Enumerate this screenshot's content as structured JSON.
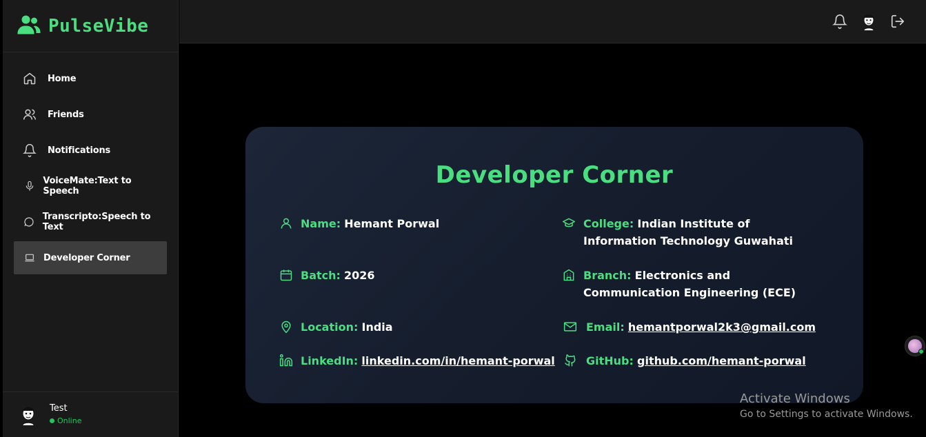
{
  "brand": {
    "name": "PulseVibe"
  },
  "sidebar": {
    "items": [
      {
        "label": "Home"
      },
      {
        "label": "Friends"
      },
      {
        "label": "Notifications"
      },
      {
        "label": "VoiceMate:Text to Speech"
      },
      {
        "label": "Transcripto:Speech to Text"
      },
      {
        "label": "Developer Corner",
        "active": true
      }
    ]
  },
  "user": {
    "name": "Test",
    "status": "Online"
  },
  "header": {
    "icons": [
      "bell-icon",
      "avatar",
      "logout-icon"
    ]
  },
  "card": {
    "title": "Developer Corner",
    "fields": {
      "name": {
        "key": "Name:",
        "value": "Hemant Porwal"
      },
      "college": {
        "key": "College:",
        "value": "Indian Institute of Information Technology Guwahati"
      },
      "batch": {
        "key": "Batch:",
        "value": "2026"
      },
      "branch": {
        "key": "Branch:",
        "value": "Electronics and Communication Engineering (ECE)"
      },
      "location": {
        "key": "Location:",
        "value": "India"
      },
      "email": {
        "key": "Email:",
        "value": "hemantporwal2k3@gmail.com"
      },
      "linkedin": {
        "key": "LinkedIn:",
        "value": "linkedin.com/in/hemant-porwal"
      },
      "github": {
        "key": "GitHub:",
        "value": "github.com/hemant-porwal"
      }
    }
  },
  "watermark": {
    "line1": "Activate Windows",
    "line2": "Go to Settings to activate Windows."
  },
  "colors": {
    "accent": "#4ade80",
    "sidebar_bg": "#1a1a1a",
    "card_bg": "#1a2233",
    "online": "#22c55e"
  }
}
